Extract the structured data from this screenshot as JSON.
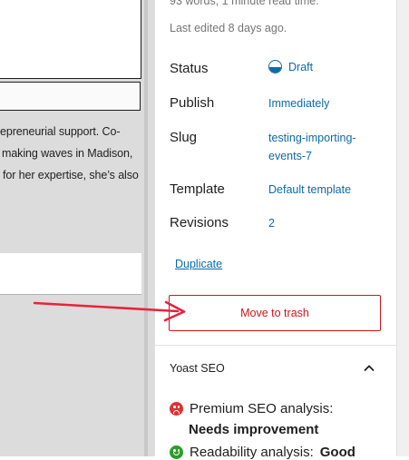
{
  "editor": {
    "paragraph_lines": [
      "epreneurial support. Co-",
      "making waves in Madison,",
      "for her expertise, she’s also"
    ]
  },
  "sidebar": {
    "word_count_text": "93 words, 1 minute read time.",
    "last_edited": "Last edited 8 days ago.",
    "status_label": "Status",
    "status_value": "Draft",
    "publish_label": "Publish",
    "publish_value": "Immediately",
    "slug_label": "Slug",
    "slug_value_line1": "testing-importing-",
    "slug_value_line2": "events-7",
    "template_label": "Template",
    "template_value": "Default template",
    "revisions_label": "Revisions",
    "revisions_value": "2",
    "duplicate_label": "Duplicate",
    "trash_label": "Move to trash"
  },
  "yoast": {
    "title": "Yoast SEO",
    "premium_label": "Premium SEO analysis:",
    "premium_result": "Needs improvement",
    "readability_label": "Readability analysis:",
    "readability_result": "Good"
  },
  "colors": {
    "link": "#0b6ba8",
    "danger": "#cc1818",
    "annotation_arrow": "#e8233a",
    "seo_bad": "#dc3232",
    "seo_good": "#2a9d2a"
  },
  "icons": [
    "draft-status-icon",
    "chevron-up-icon",
    "sad-face-icon",
    "smile-face-icon"
  ]
}
